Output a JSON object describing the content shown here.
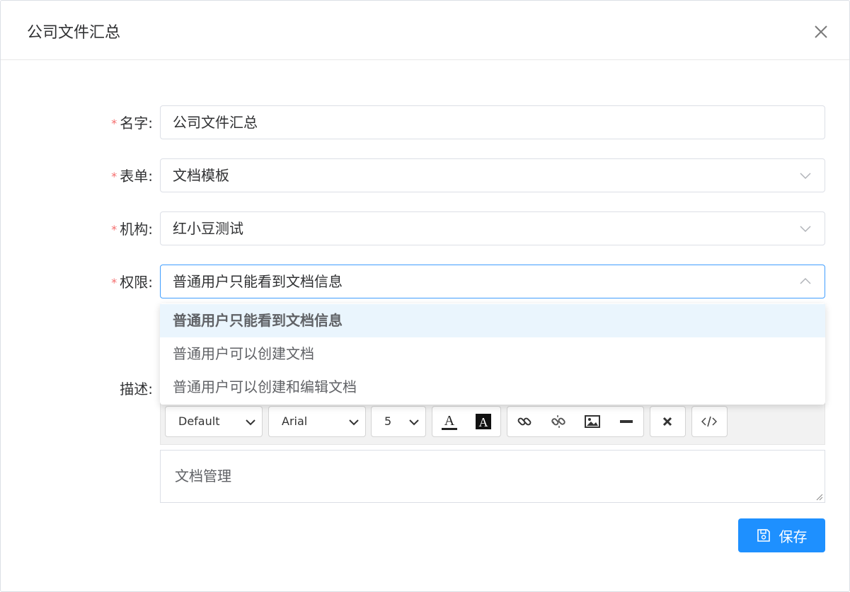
{
  "dialog": {
    "title": "公司文件汇总"
  },
  "form": {
    "name": {
      "label": "名字:",
      "value": "公司文件汇总",
      "required": true
    },
    "form_select": {
      "label": "表单:",
      "value": "文档模板",
      "required": true
    },
    "org": {
      "label": "机构:",
      "value": "红小豆测试",
      "required": true
    },
    "permission": {
      "label": "权限:",
      "value": "普通用户只能看到文档信息",
      "required": true,
      "options": [
        "普通用户只能看到文档信息",
        "普通用户可以创建文档",
        "普通用户可以创建和编辑文档"
      ]
    },
    "description": {
      "label": "描述:",
      "toolbar": {
        "format_select": "Default",
        "font_select": "Arial",
        "size_select": "5"
      },
      "content": "文档管理"
    }
  },
  "actions": {
    "save_label": "保存"
  },
  "colors": {
    "primary": "#1e90ff",
    "required": "#f56c6c",
    "selected_bg": "#eaf5fd",
    "focus_border": "#409eff"
  }
}
